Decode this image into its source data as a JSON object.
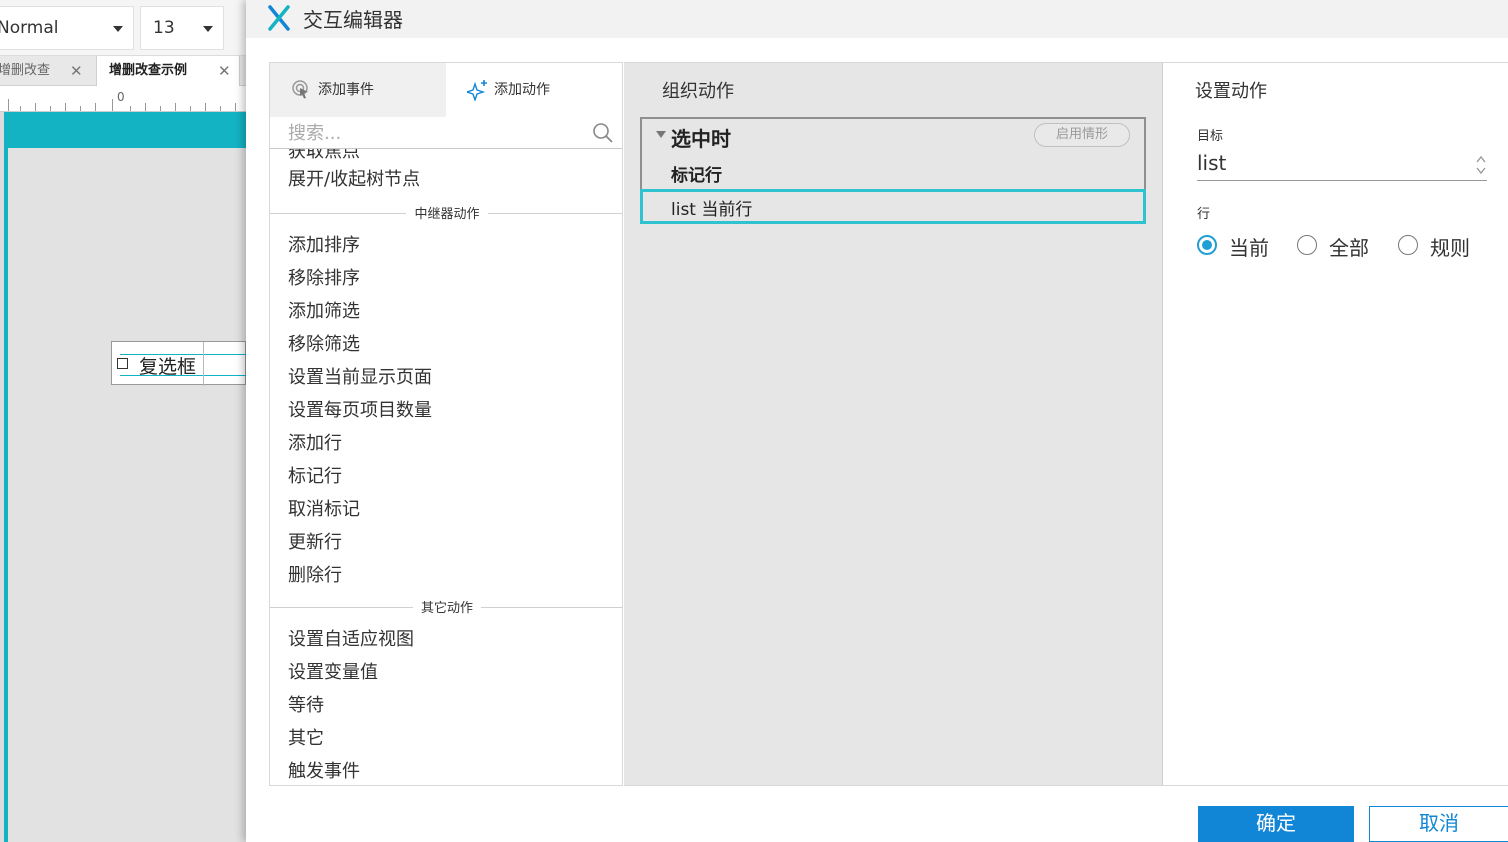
{
  "editor": {
    "font_style": "Normal",
    "font_size": "13",
    "tabs": [
      {
        "label": "增删改查"
      },
      {
        "label": "增删改查示例"
      }
    ],
    "ruler_zero": "0",
    "widget_label": "复选框"
  },
  "dialog": {
    "title": "交互编辑器",
    "tabs": {
      "add_event": "添加事件",
      "add_action": "添加动作"
    },
    "search_placeholder": "搜索...",
    "partial_item": "获取焦点",
    "items_top": [
      "展开/收起树节点"
    ],
    "groups": {
      "repeater": {
        "label": "中继器动作",
        "items": [
          "添加排序",
          "移除排序",
          "添加筛选",
          "移除筛选",
          "设置当前显示页面",
          "设置每页项目数量",
          "添加行",
          "标记行",
          "取消标记",
          "更新行",
          "删除行"
        ]
      },
      "other": {
        "label": "其它动作",
        "items": [
          "设置自适应视图",
          "设置变量值",
          "等待",
          "其它",
          "触发事件"
        ]
      }
    },
    "organize": {
      "title": "组织动作",
      "case_name": "选中时",
      "enable_condition": "启用情形",
      "action_name": "标记行",
      "action_detail": "list 当前行"
    },
    "config": {
      "title": "设置动作",
      "target_label": "目标",
      "target_value": "list",
      "row_label": "行",
      "row_options": [
        "当前",
        "全部",
        "规则"
      ],
      "row_selected": "当前"
    },
    "buttons": {
      "ok": "确定",
      "cancel": "取消"
    }
  },
  "colors": {
    "accent": "#1185d6",
    "teal": "#13b3c4",
    "selection_border": "#2ec3cf",
    "radio_checked": "#1f9fd6"
  }
}
